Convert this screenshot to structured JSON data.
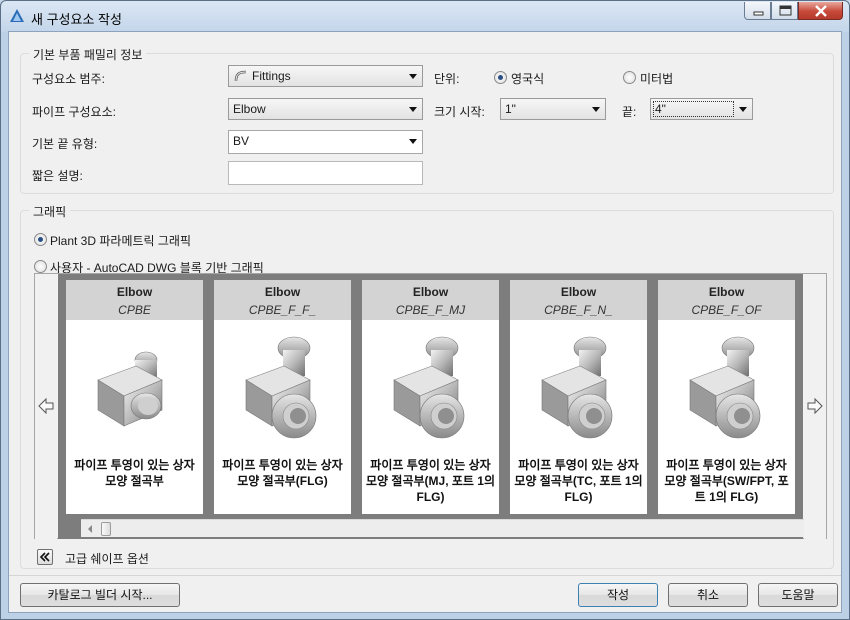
{
  "window": {
    "title": "새 구성요소 작성"
  },
  "basic_info": {
    "group_title": "기본 부품 패밀리 정보",
    "category_label": "구성요소 범주:",
    "category_value": "Fittings",
    "pipe_component_label": "파이프 구성요소:",
    "pipe_component_value": "Elbow",
    "end_type_label": "기본 끝 유형:",
    "end_type_value": "BV",
    "short_desc_label": "짧은 설명:",
    "short_desc_value": "",
    "units_label": "단위:",
    "unit_imperial": "영국식",
    "unit_metric": "미터법",
    "size_start_label": "크기 시작:",
    "size_start_value": "1\"",
    "size_end_label": "끝:",
    "size_end_value": "4\""
  },
  "graphics": {
    "group_title": "그래픽",
    "option_parametric": "Plant 3D 파라메트릭 그래픽",
    "option_user": "사용자 - AutoCAD DWG 블록 기반 그래픽",
    "selected_option": "parametric",
    "cards": [
      {
        "title": "Elbow",
        "code": "CPBE",
        "desc": "파이프 투영이 있는 상자 모양 절곡부"
      },
      {
        "title": "Elbow",
        "code": "CPBE_F_F_",
        "desc": "파이프 투영이 있는 상자 모양 절곡부(FLG)"
      },
      {
        "title": "Elbow",
        "code": "CPBE_F_MJ",
        "desc": "파이프 투영이 있는 상자 모양 절곡부(MJ, 포트 1의 FLG)"
      },
      {
        "title": "Elbow",
        "code": "CPBE_F_N_",
        "desc": "파이프 투영이 있는 상자 모양 절곡부(TC, 포트 1의 FLG)"
      },
      {
        "title": "Elbow",
        "code": "CPBE_F_OF",
        "desc": "파이프 투영이 있는 상자 모양 절곡부(SW/FPT, 포트 1의 FLG)"
      }
    ],
    "advanced_label": "고급 쉐이프 옵션"
  },
  "footer": {
    "catalog_builder": "카탈로그 빌더 시작...",
    "create": "작성",
    "cancel": "취소",
    "help": "도움말"
  },
  "icons": {
    "app": "autocad-plant-icon",
    "category": "pipe-fitting-icon",
    "prev": "arrow-left-icon",
    "next": "arrow-right-icon",
    "collapse": "double-chevron-left-icon"
  },
  "colors": {
    "title_bar": "#c4d6ea",
    "close_button": "#c7493a",
    "gallery_bg": "#7d7d7d",
    "card_header": "#d3d3d3"
  }
}
